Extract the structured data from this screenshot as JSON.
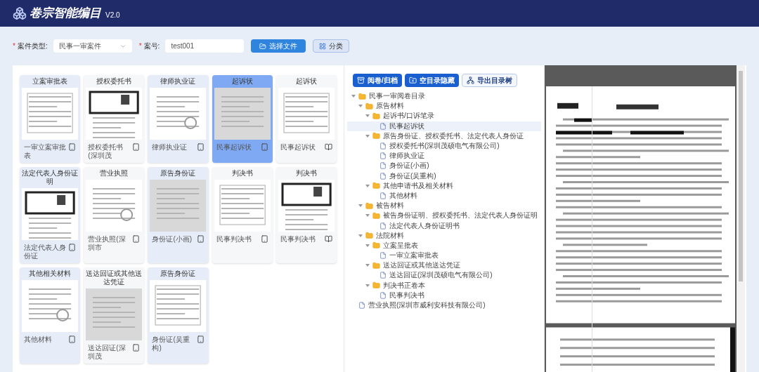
{
  "header": {
    "title": "卷宗智能编目",
    "version": "V2.0"
  },
  "form": {
    "case_type": {
      "label": "案件类型:",
      "required_mark": "*",
      "value": "民事一审案件"
    },
    "case_number": {
      "label": "案号:",
      "required_mark": "*",
      "value": "test001"
    },
    "buttons": [
      {
        "label": "选择文件",
        "kind": "primary"
      },
      {
        "label": "分类",
        "kind": "secondary"
      }
    ]
  },
  "thumbnails": [
    {
      "title": "立案审批表",
      "label": "一审立案审批表",
      "selected": false,
      "shaded": true,
      "kind": "page"
    },
    {
      "title": "授权委托书",
      "label": "授权委托书(深圳茂",
      "selected": false,
      "shaded": false,
      "kind": "page"
    },
    {
      "title": "律师执业证",
      "label": "律师执业证",
      "selected": false,
      "shaded": true,
      "kind": "page"
    },
    {
      "title": "起诉状",
      "label": "民事起诉状",
      "selected": true,
      "kind": "page"
    },
    {
      "title": "起诉状",
      "label": "民事起诉状",
      "selected": false,
      "shaded": false,
      "kind": "spread"
    },
    {
      "title": "法定代表人身份证明",
      "label": "法定代表人身份证",
      "selected": false,
      "shaded": true,
      "kind": "page"
    },
    {
      "title": "营业执照",
      "label": "营业执照(深圳市",
      "selected": false,
      "shaded": false,
      "kind": "page"
    },
    {
      "title": "原告身份证",
      "label": "身份证(小画)",
      "selected": false,
      "shaded": true,
      "kind": "page"
    },
    {
      "title": "判决书",
      "label": "民事判决书",
      "selected": false,
      "shaded": false,
      "kind": "page"
    },
    {
      "title": "判决书",
      "label": "民事判决书",
      "selected": false,
      "shaded": false,
      "kind": "spread"
    },
    {
      "title": "其他相关材料",
      "label": "其他材料",
      "selected": false,
      "shaded": true,
      "kind": "page"
    },
    {
      "title": "送达回证或其他送达凭证",
      "label": "送达回证(深圳茂",
      "selected": false,
      "shaded": false,
      "kind": "page"
    },
    {
      "title": "原告身份证",
      "label": "身份证(吴重构)",
      "selected": false,
      "shaded": true,
      "kind": "page"
    }
  ],
  "tree_toolbar": [
    {
      "label": "阅卷/归档",
      "kind": "primary"
    },
    {
      "label": "空目录隐藏",
      "kind": "primary"
    },
    {
      "label": "导出目录树",
      "kind": "secondary"
    }
  ],
  "tree": [
    {
      "label": "民事一审阅卷目录",
      "kind": "folder",
      "expanded": true,
      "selected": false,
      "children": [
        {
          "label": "原告材料",
          "kind": "folder",
          "expanded": true,
          "selected": false,
          "children": [
            {
              "label": "起诉书/口诉笔录",
              "kind": "folder",
              "expanded": true,
              "selected": false,
              "children": [
                {
                  "label": "民事起诉状",
                  "kind": "file",
                  "selected": true
                }
              ]
            },
            {
              "label": "原告身份证、授权委托书、法定代表人身份证",
              "kind": "folder",
              "expanded": true,
              "selected": false,
              "children": [
                {
                  "label": "授权委托书(深圳茂硕电气有限公司)",
                  "kind": "file",
                  "selected": false
                },
                {
                  "label": "律师执业证",
                  "kind": "file",
                  "selected": false
                },
                {
                  "label": "身份证(小画)",
                  "kind": "file",
                  "selected": false
                },
                {
                  "label": "身份证(吴重构)",
                  "kind": "file",
                  "selected": false
                }
              ]
            },
            {
              "label": "其他申请书及相关材料",
              "kind": "folder",
              "expanded": true,
              "selected": false,
              "children": [
                {
                  "label": "其他材料",
                  "kind": "file",
                  "selected": false
                }
              ]
            }
          ]
        },
        {
          "label": "被告材料",
          "kind": "folder",
          "expanded": true,
          "selected": false,
          "children": [
            {
              "label": "被告身份证明、授权委托书、法定代表人身份证明",
              "kind": "folder",
              "expanded": true,
              "selected": false,
              "children": [
                {
                  "label": "法定代表人身份证明书",
                  "kind": "file",
                  "selected": false
                }
              ]
            }
          ]
        },
        {
          "label": "法院材料",
          "kind": "folder",
          "expanded": true,
          "selected": false,
          "children": [
            {
              "label": "立案呈批表",
              "kind": "folder",
              "expanded": true,
              "selected": false,
              "children": [
                {
                  "label": "一审立案审批表",
                  "kind": "file",
                  "selected": false
                }
              ]
            },
            {
              "label": "送达回证或其他送达凭证",
              "kind": "folder",
              "expanded": true,
              "selected": false,
              "children": [
                {
                  "label": "送达回证(深圳茂硕电气有限公司)",
                  "kind": "file",
                  "selected": false
                }
              ]
            },
            {
              "label": "判决书正卷本",
              "kind": "folder",
              "expanded": true,
              "selected": false,
              "children": [
                {
                  "label": "民事判决书",
                  "kind": "file",
                  "selected": false
                }
              ]
            }
          ]
        }
      ]
    },
    {
      "label": "营业执照(深圳市威利安科技有限公司)",
      "kind": "file",
      "selected": false
    }
  ]
}
